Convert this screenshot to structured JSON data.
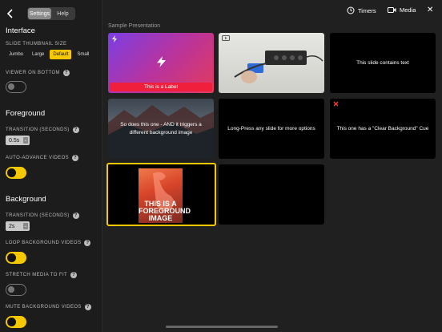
{
  "sidebar": {
    "tabs": [
      "Settings",
      "Help"
    ],
    "interface_title": "Interface",
    "thumb_size_label": "SLIDE THUMBNAIL SIZE",
    "sizes": [
      "Jumbo",
      "Large",
      "Default",
      "Small"
    ],
    "selected_size": "Default",
    "viewer_bottom_label": "VIEWER ON BOTTOM",
    "viewer_bottom_on": false,
    "foreground_title": "Foreground",
    "fg_transition_label": "TRANSITION (SECONDS)",
    "fg_transition_value": "0.5s",
    "auto_advance_label": "AUTO-ADVANCE VIDEOS",
    "auto_advance_on": true,
    "background_title": "Background",
    "bg_transition_label": "TRANSITION (SECONDS)",
    "bg_transition_value": "2s",
    "loop_bg_label": "LOOP BACKGROUND VIDEOS",
    "loop_bg_on": true,
    "stretch_label": "STRETCH MEDIA TO FIT",
    "stretch_on": false,
    "mute_bg_label": "MUTE BACKGROUND VIDEOS",
    "mute_bg_on": true,
    "help_glyph": "?"
  },
  "topbar": {
    "timers_label": "Timers",
    "media_label": "Media",
    "close_glyph": "✕"
  },
  "presentation": {
    "title": "Sample Presentation",
    "slides": [
      {
        "label": "This is a Label"
      },
      {
        "label": ""
      },
      {
        "label": "This slide contains text"
      },
      {
        "label": "So does this one - AND it triggers a different background image"
      },
      {
        "label": "Long-Press any slide for more options"
      },
      {
        "label": "This one has a \"Clear Background\" Cue"
      },
      {
        "label": "THIS IS A FOREGROUND IMAGE"
      },
      {
        "label": ""
      }
    ]
  },
  "colors": {
    "accent": "#f6c800"
  }
}
